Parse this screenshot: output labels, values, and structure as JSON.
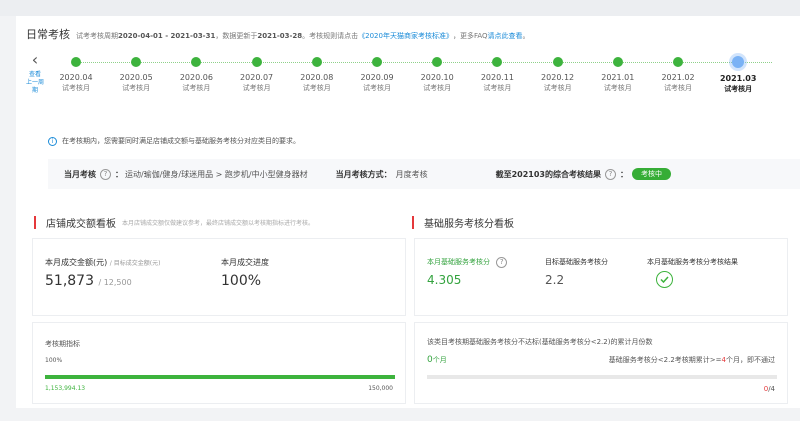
{
  "header": {
    "title": "日常考核",
    "desc_prefix": "试考考核周期",
    "period": "2020-04-01 - 2021-03-31",
    "desc_mid": "，数据更新于",
    "updated": "2021-03-28",
    "desc_mid2": "。考核规则请点击",
    "rule_link": "《2020年天猫商家考核标准》",
    "desc_mid3": "，更多FAQ",
    "faq_link": "请点此查看",
    "desc_end": "。"
  },
  "back": {
    "chevron": "‹",
    "label_line1": "查看",
    "label_line2": "上一周期"
  },
  "timeline": [
    {
      "period": "2020.04",
      "label": "试考核月",
      "current": false
    },
    {
      "period": "2020.05",
      "label": "试考核月",
      "current": false
    },
    {
      "period": "2020.06",
      "label": "试考核月",
      "current": false
    },
    {
      "period": "2020.07",
      "label": "试考核月",
      "current": false
    },
    {
      "period": "2020.08",
      "label": "试考核月",
      "current": false
    },
    {
      "period": "2020.09",
      "label": "试考核月",
      "current": false
    },
    {
      "period": "2020.10",
      "label": "试考核月",
      "current": false
    },
    {
      "period": "2020.11",
      "label": "试考核月",
      "current": false
    },
    {
      "period": "2020.12",
      "label": "试考核月",
      "current": false
    },
    {
      "period": "2021.01",
      "label": "试考核月",
      "current": false
    },
    {
      "period": "2021.02",
      "label": "试考核月",
      "current": false
    },
    {
      "period": "2021.03",
      "label": "试考核月",
      "current": true
    }
  ],
  "notice": {
    "icon": "info-icon",
    "text": "在考核期内，您需要同时满足店铺成交额与基础服务考核分对应类目的要求。"
  },
  "summary": {
    "month_label": "当月考核",
    "colon": "：",
    "category": "运动/瑜伽/健身/球迷用品 > 跑步机/中小型健身器材",
    "method_label": "当月考核方式：",
    "method": "月度考核",
    "result_label": "截至202103的综合考核结果",
    "result_badge": "考核中"
  },
  "left_section": {
    "title": "店铺成交额看板",
    "subtitle": "本月店铺成交额仅做建议参考，最终店铺成交额以考核期指标进行考核。",
    "amount_label": "本月成交金额(元)",
    "target_label": "/ 目标成交金额(元)",
    "amount": "51,873",
    "target": "12,500",
    "progress_label": "本月成交进度",
    "progress": "100%",
    "kpi_label": "考核期指标",
    "kpi_pct": "100%",
    "kpi_progress": 1.0,
    "kpi_current": "1,153,994.13",
    "kpi_target": "150,000"
  },
  "right_section": {
    "title": "基础服务考核分看板",
    "score_label": "本月基础服务考核分",
    "score": "4.305",
    "target_label": "目标基础服务考核分",
    "target": "2.2",
    "result_label": "本月基础服务考核分考核结果",
    "fail_label": "该类目考核期基础服务考核分不达标(基础服务考核分<2.2)的累计月份数",
    "fail_count": "0",
    "fail_unit": "个月",
    "rule_text_prefix": "基础服务考核分<2.2考核期累计>=",
    "rule_num": "4",
    "rule_text_suffix": "个月，即不通过",
    "fail_progress": 0.0,
    "fail_ratio_num": "0",
    "fail_ratio_den": "/4"
  },
  "colors": {
    "green": "#3db33d",
    "accent_red": "#e5383b",
    "link_blue": "#1a8bd8",
    "current_dot": "#7ab2f5"
  }
}
